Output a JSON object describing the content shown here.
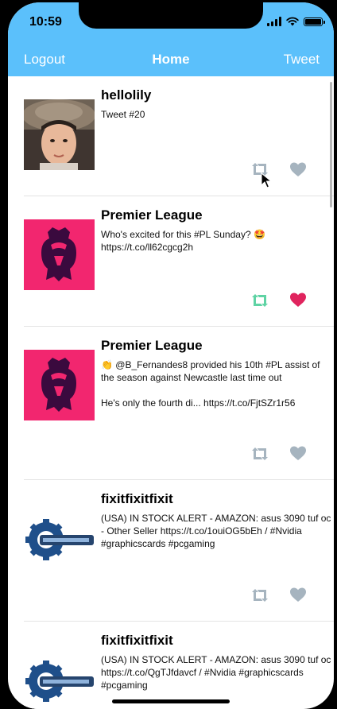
{
  "status_bar": {
    "time": "10:59"
  },
  "nav": {
    "left": "Logout",
    "title": "Home",
    "right": "Tweet"
  },
  "tweets": [
    {
      "name": "hellolily",
      "text": "Tweet #20",
      "avatar": "user-photo",
      "liked": false,
      "retweeted": false
    },
    {
      "name": "Premier League",
      "text": "Who's excited for this #PL Sunday? 🤩 https://t.co/ll62cgcg2h",
      "avatar": "premier-league-logo",
      "liked": true,
      "retweeted": true
    },
    {
      "name": "Premier League",
      "text": "👏 @B_Fernandes8 provided his 10th #PL assist of the season against Newcastle last time out\n\nHe's only the fourth di... https://t.co/FjtSZr1r56",
      "avatar": "premier-league-logo",
      "liked": false,
      "retweeted": false
    },
    {
      "name": "fixitfixitfixit",
      "text": "(USA) IN STOCK ALERT - AMAZON: asus 3090 tuf oc - Other Seller https://t.co/1ouiOG5bEh / #Nvidia #graphicscards #pcgaming",
      "avatar": "fixit-logo",
      "liked": false,
      "retweeted": false
    },
    {
      "name": "fixitfixitfixit",
      "text": "(USA) IN STOCK ALERT - AMAZON: asus 3090 tuf oc https://t.co/QgTJfdavcf / #Nvidia #graphicscards #pcgaming",
      "avatar": "fixit-logo",
      "liked": false,
      "retweeted": false
    }
  ],
  "colors": {
    "header": "#5bc0fb",
    "icon_inactive": "#a6b4bf",
    "retweet_active": "#5fd3a4",
    "like_active": "#e0245e",
    "premier_league_bg": "#f2266f"
  }
}
